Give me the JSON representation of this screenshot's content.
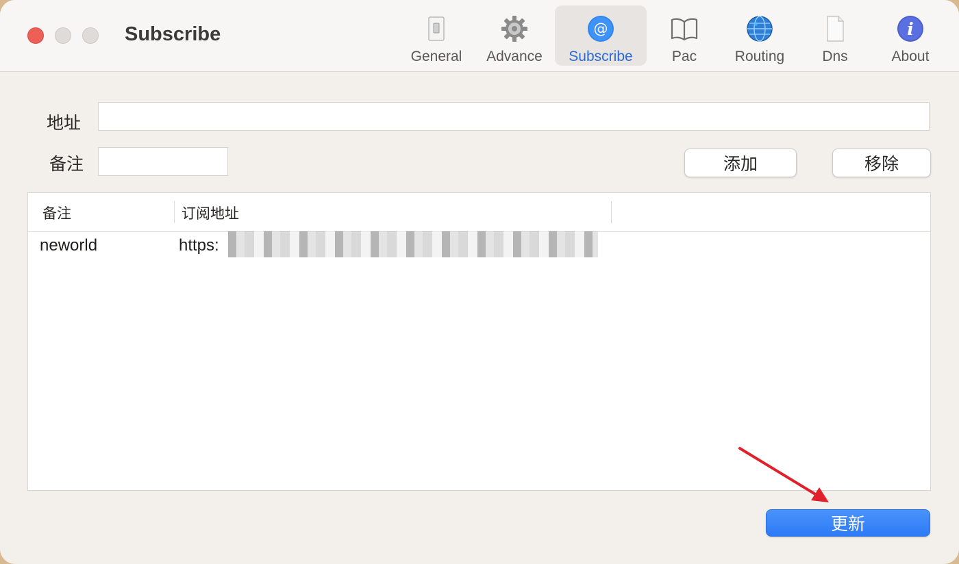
{
  "window": {
    "title": "Subscribe"
  },
  "toolbar": {
    "tabs": [
      {
        "label": "General",
        "icon": "switch-icon"
      },
      {
        "label": "Advance",
        "icon": "gear-icon"
      },
      {
        "label": "Subscribe",
        "icon": "at-icon",
        "active": true
      },
      {
        "label": "Pac",
        "icon": "book-icon"
      },
      {
        "label": "Routing",
        "icon": "globe-icon"
      },
      {
        "label": "Dns",
        "icon": "document-icon"
      },
      {
        "label": "About",
        "icon": "info-icon"
      }
    ]
  },
  "form": {
    "address_label": "地址",
    "address_value": "",
    "remark_label": "备注",
    "remark_value": "",
    "add_label": "添加",
    "remove_label": "移除"
  },
  "table": {
    "columns": [
      "备注",
      "订阅地址"
    ],
    "rows": [
      {
        "remark": "neworld",
        "url": "https:"
      }
    ]
  },
  "update_label": "更新",
  "colors": {
    "accent": "#2a6ad8",
    "close": "#ee5f58",
    "primary_button": "#2c7af6",
    "annotation_arrow": "#e0202a"
  }
}
